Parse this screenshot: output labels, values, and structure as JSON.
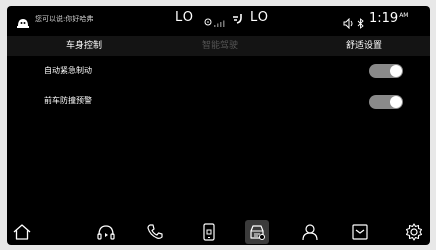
{
  "status_bar": {
    "voice_hint": "您可以说:你好哈弗",
    "temp_left": "LO",
    "temp_right": "LO",
    "clock_time": "1:19",
    "clock_ampm": "AM"
  },
  "tabs": [
    {
      "label": "车身控制",
      "state": "normal"
    },
    {
      "label": "智能驾驶",
      "state": "disabled"
    },
    {
      "label": "舒适设置",
      "state": "normal"
    }
  ],
  "settings": [
    {
      "label": "自动紧急制动",
      "enabled": true
    },
    {
      "label": "前车防撞预警",
      "enabled": true
    }
  ],
  "dock": {
    "icons": [
      "home-icon",
      "music-icon",
      "phone-icon",
      "phone-mirror-icon",
      "vehicle-settings-icon",
      "profile-icon",
      "app-store-icon",
      "settings-gear-icon"
    ],
    "active": "vehicle-settings-icon"
  },
  "colors": {
    "background": "#000000",
    "tab_bar": "#141414",
    "toggle_track": "#8a8a8a",
    "disabled_text": "#555555"
  }
}
